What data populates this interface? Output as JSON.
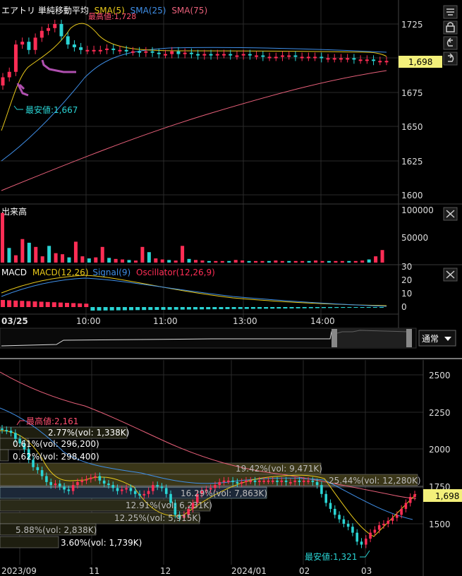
{
  "intraday": {
    "legend": {
      "name": "エアトリ 単純移動平均",
      "sma5": "SMA(5)",
      "sma25": "SMA(25)",
      "sma75": "SMA(75)"
    },
    "colors": {
      "up": "#ff2d55",
      "down": "#2ad4d4",
      "sma5": "#e8c81a",
      "sma25": "#3f8fe8",
      "sma75": "#e8607a",
      "mark": "#b050b0"
    },
    "high_label": "最高値:1,728",
    "low_label": "最安値:1,667",
    "price_badge": "1,698",
    "y_ticks": [
      "1725",
      "1700",
      "1675",
      "1650",
      "1625",
      "1600"
    ],
    "volume_label": "出来高",
    "volume_ticks": [
      "100000",
      "50000"
    ],
    "macd": {
      "title": "MACD",
      "macd": "MACD(12,26)",
      "signal": "Signal(9)",
      "osc": "Oscillator(12,26,9)",
      "ticks": [
        "30",
        "20",
        "10",
        "0"
      ]
    },
    "time_axis": [
      "03/25",
      "10:00",
      "11:00",
      "13:00",
      "14:00"
    ],
    "mode_select": "通常"
  },
  "daily": {
    "y_ticks": [
      "2500",
      "2250",
      "2000",
      "1750",
      "1500"
    ],
    "x_ticks": [
      "2023/09",
      "11",
      "12",
      "2024/01",
      "02",
      "03"
    ],
    "price_badge": "1,698",
    "high_label": "最高値:2,161",
    "low_label": "最安値:1,321",
    "volume_profile": [
      "2.77%(vol: 1,338K)",
      "0.61%(vol: 296,200)",
      "0.62%(vol: 298,400)",
      "19.42%(vol: 9,471K)",
      "25.44%(vol: 12,280K)",
      "16.29%(vol: 7,863K)",
      "12.91%(vol: 6,231K)",
      "12.25%(vol: 5,915K)",
      "5.88%(vol: 2,838K)",
      "3.60%(vol: 1,739K)"
    ]
  },
  "chart_data": [
    {
      "type": "candlestick",
      "title": "エアトリ 単純移動平均",
      "series": [
        {
          "name": "SMA(5)"
        },
        {
          "name": "SMA(25)"
        },
        {
          "name": "SMA(75)"
        }
      ],
      "x": [
        "03/25 09:00",
        "10:00",
        "11:00",
        "13:00",
        "14:00"
      ],
      "ylim": [
        1595,
        1740
      ],
      "high": 1728,
      "low": 1667,
      "last": 1698,
      "values": [
        1686,
        1690,
        1710,
        1712,
        1706,
        1715,
        1720,
        1722,
        1725,
        1716,
        1710,
        1708,
        1706,
        1706,
        1706,
        1706,
        1707,
        1706,
        1706,
        1705,
        1705,
        1704,
        1705,
        1704,
        1703,
        1703,
        1705,
        1703,
        1704,
        1703,
        1702,
        1703,
        1702,
        1703,
        1703,
        1702,
        1702,
        1703,
        1702,
        1702,
        1701,
        1701,
        1701,
        1702,
        1702,
        1701,
        1701,
        1701,
        1701,
        1700,
        1700,
        1700,
        1700,
        1700,
        1699,
        1699,
        1699,
        1698,
        1698,
        1698
      ],
      "sma75": [
        1603,
        1628,
        1652,
        1675,
        1688,
        1694
      ]
    },
    {
      "type": "bar",
      "ylabel": "出来高",
      "ylim": [
        0,
        100000
      ],
      "values": [
        95000,
        28000,
        14000,
        45000,
        38000,
        30000,
        12000,
        32000,
        18000,
        16000,
        10000,
        40000,
        12000,
        8000,
        10000,
        30000,
        9000,
        7000,
        6000,
        5000,
        4000,
        30000,
        20000,
        8000,
        6000,
        5000,
        4000,
        32000,
        7000,
        5000,
        4000,
        3000,
        3000,
        3000,
        3000,
        5000,
        4000,
        3000,
        3000,
        3000,
        3000,
        4000,
        3000,
        3000,
        3000,
        3000,
        3000,
        4000,
        3000,
        3000,
        3000,
        3000,
        3000,
        3000,
        4000,
        6000,
        12000,
        24000
      ]
    },
    {
      "type": "line",
      "title": "MACD",
      "series": [
        {
          "name": "MACD(12,26)"
        },
        {
          "name": "Signal(9)"
        },
        {
          "name": "Oscillator(12,26,9)"
        }
      ],
      "ylim": [
        -2,
        32
      ]
    },
    {
      "type": "candlestick",
      "x": [
        "2023/09",
        "11",
        "12",
        "2024/01",
        "02",
        "03"
      ],
      "ylim": [
        1250,
        2550
      ],
      "high": 2161,
      "low": 1321,
      "last": 1698,
      "values": [
        2130,
        2125,
        2110,
        2070,
        2040,
        2000,
        1930,
        1880,
        1860,
        1820,
        1780,
        1760,
        1770,
        1750,
        1730,
        1720,
        1760,
        1780,
        1790,
        1800,
        1810,
        1820,
        1790,
        1770,
        1760,
        1740,
        1720,
        1730,
        1740,
        1720,
        1700,
        1690,
        1700,
        1720,
        1760,
        1750,
        1740,
        1700,
        1640,
        1560,
        1540,
        1560,
        1600,
        1640,
        1700,
        1720,
        1730,
        1740,
        1760,
        1780,
        1790,
        1790,
        1780,
        1770,
        1780,
        1790,
        1790,
        1780,
        1790,
        1790,
        1790,
        1790,
        1780,
        1790,
        1780,
        1780,
        1790,
        1780,
        1790,
        1790,
        1780,
        1760,
        1700,
        1640,
        1600,
        1560,
        1530,
        1500,
        1480,
        1440,
        1380,
        1360,
        1400,
        1440,
        1460,
        1490,
        1500,
        1520,
        1540,
        1560,
        1600,
        1640,
        1680,
        1698
      ],
      "sma75": [
        2420,
        2320,
        2180,
        2060,
        1970,
        1890,
        1820,
        1790,
        1780,
        1770,
        1750,
        1735,
        1720,
        1710,
        1700,
        1690,
        1690
      ]
    }
  ]
}
